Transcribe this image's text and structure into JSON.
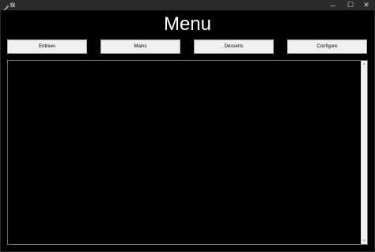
{
  "window": {
    "title": "tk",
    "icon": "feather-icon",
    "controls": {
      "minimize": "─",
      "maximize": "☐",
      "close": "✕"
    }
  },
  "main": {
    "heading": "Menu",
    "buttons": [
      {
        "label": "Entrees"
      },
      {
        "label": "Mains"
      },
      {
        "label": "Desserts"
      },
      {
        "label": "Configure"
      }
    ],
    "content_area": {
      "scroll_up": "▲",
      "scroll_down": "▼"
    }
  },
  "colors": {
    "background": "#000000",
    "titlebar": "#2b2b2b",
    "button_face": "#f0f0f0",
    "heading_text": "#ffffff"
  }
}
